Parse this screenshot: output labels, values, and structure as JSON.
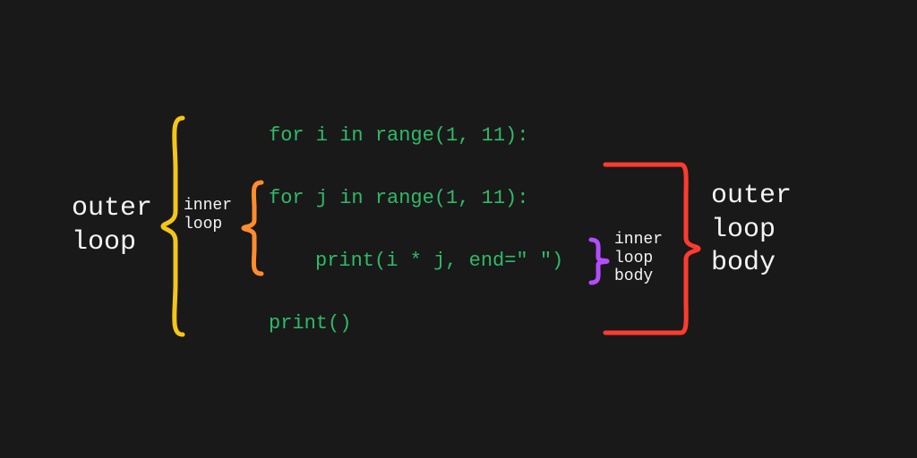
{
  "labels": {
    "outer_loop": "outer\nloop",
    "inner_loop": "inner\nloop",
    "outer_body": "outer\nloop\nbody",
    "inner_body": "inner\nloop\nbody"
  },
  "code": {
    "line1": "for i in range(1, 11):",
    "line2": "for j in range(1, 11):",
    "line3": "print(i * j, end=\" \")",
    "line4": "print()"
  },
  "colors": {
    "code": "#2fbb67",
    "brace_outer_left": "#f5c518",
    "brace_inner_left": "#ff8c2e",
    "brace_inner_right": "#b44cff",
    "brace_outer_right": "#ff3b30",
    "text": "#f4f4f4",
    "bg": "#191919"
  }
}
